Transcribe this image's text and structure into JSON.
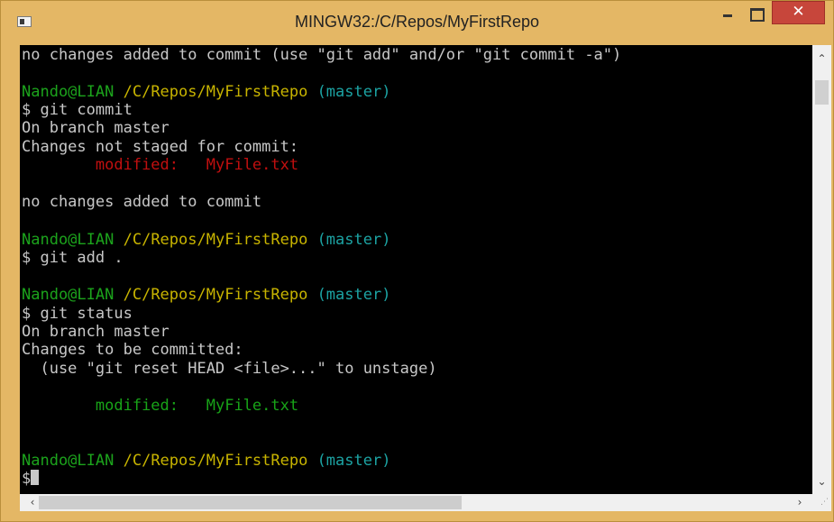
{
  "window": {
    "title": "MINGW32:/C/Repos/MyFirstRepo",
    "close_glyph": "✕",
    "accent_color": "#e4b765",
    "close_color": "#c7463b"
  },
  "terminal": {
    "background": "#000000",
    "lines": [
      {
        "text": "no changes added to commit (use \"git add\" and/or \"git commit -a\")"
      },
      {
        "user": "Nando@LIAN",
        "path": "/C/Repos/MyFirstRepo",
        "branch": "(master)"
      },
      {
        "text": "$ git commit"
      },
      {
        "text": "On branch master"
      },
      {
        "text": "Changes not staged for commit:"
      },
      {
        "label": "modified:",
        "file": "MyFile.txt",
        "color": "red"
      },
      {
        "text": "no changes added to commit"
      },
      {
        "user": "Nando@LIAN",
        "path": "/C/Repos/MyFirstRepo",
        "branch": "(master)"
      },
      {
        "text": "$ git add ."
      },
      {
        "user": "Nando@LIAN",
        "path": "/C/Repos/MyFirstRepo",
        "branch": "(master)"
      },
      {
        "text": "$ git status"
      },
      {
        "text": "On branch master"
      },
      {
        "text": "Changes to be committed:"
      },
      {
        "text": "  (use \"git reset HEAD <file>...\" to unstage)"
      },
      {
        "label": "modified:",
        "file": "MyFile.txt",
        "color": "green"
      },
      {
        "user": "Nando@LIAN",
        "path": "/C/Repos/MyFirstRepo",
        "branch": "(master)"
      },
      {
        "text": "$"
      }
    ]
  },
  "scrollbars": {
    "up_arrow": "⌃",
    "down_arrow": "⌄",
    "left_arrow": "‹",
    "right_arrow": "›"
  }
}
